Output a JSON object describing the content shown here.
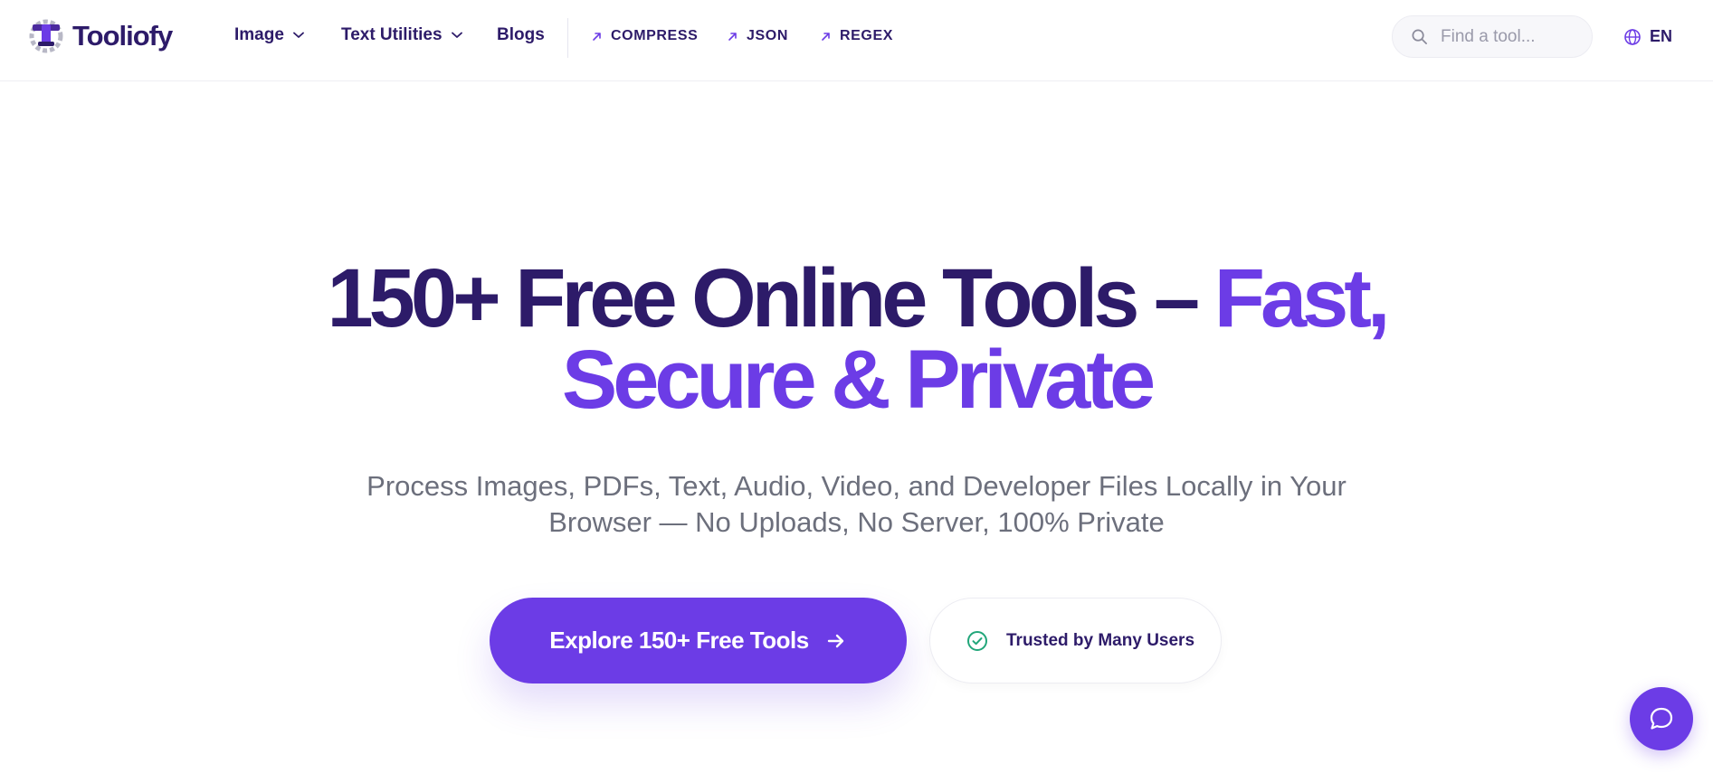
{
  "brand": {
    "name": "Tooliofy",
    "logo_icon": "wrench-gear-logo-icon"
  },
  "nav": {
    "items": [
      {
        "label": "Image",
        "has_dropdown": true
      },
      {
        "label": "Text Utilities",
        "has_dropdown": true
      },
      {
        "label": "Blogs",
        "has_dropdown": false
      }
    ],
    "quick_links": [
      {
        "label": "COMPRESS",
        "icon": "arrow-up-right-icon"
      },
      {
        "label": "JSON",
        "icon": "arrow-up-right-icon"
      },
      {
        "label": "REGEX",
        "icon": "arrow-up-right-icon"
      }
    ]
  },
  "search": {
    "placeholder": "Find a tool...",
    "value": ""
  },
  "language": {
    "label": "EN",
    "icon": "globe-icon"
  },
  "hero": {
    "title_part1": "150+ Free Online Tools – ",
    "title_accent_line1": "Fast,",
    "title_accent_line2": "Secure & Private",
    "subtitle": "Process Images, PDFs, Text, Audio, Video, and Developer Files Locally in Your Browser — No Uploads, No Server, 100% Private",
    "cta_label": "Explore 150+ Free Tools",
    "trust_label": "Trusted by Many Users"
  },
  "colors": {
    "primary": "#6c3ce6",
    "dark": "#2d1b69",
    "success": "#22a67a",
    "muted": "#6c6f7c"
  },
  "chat": {
    "icon": "chat-bubble-icon"
  }
}
